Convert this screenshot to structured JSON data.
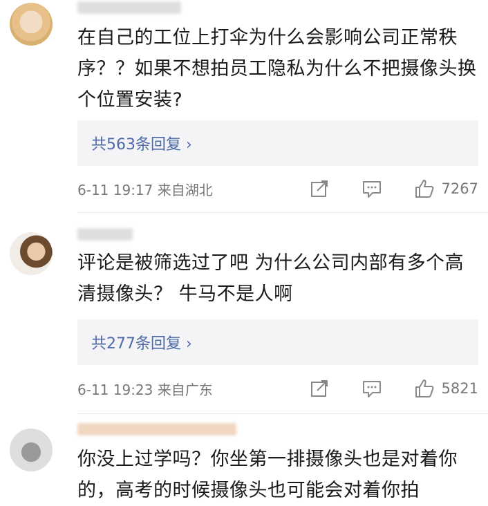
{
  "comments": [
    {
      "text": "在自己的工位上打伞为什么会影响公司正常秩序？？如果不想拍员工隐私为什么不把摄像头换个位置安装?",
      "replies_label": "共563条回复 ›",
      "time": "6-11 19:17 来自湖北",
      "likes": "7267"
    },
    {
      "text": "评论是被筛选过了吧 为什么公司内部有多个高清摄像头？ 牛马不是人啊",
      "replies_label": "共277条回复 ›",
      "time": "6-11 19:23 来自广东",
      "likes": "5821"
    },
    {
      "text": "你没上过学吗？你坐第一排摄像头也是对着你的，高考的时候摄像头也可能会对着你拍"
    }
  ],
  "icons": {
    "share": "share-icon",
    "comment": "comment-icon",
    "like": "thumbs-up-icon"
  },
  "colors": {
    "reply_link": "#4d6aa8",
    "reply_bg": "#f4f4f6",
    "meta_text": "#777777"
  }
}
